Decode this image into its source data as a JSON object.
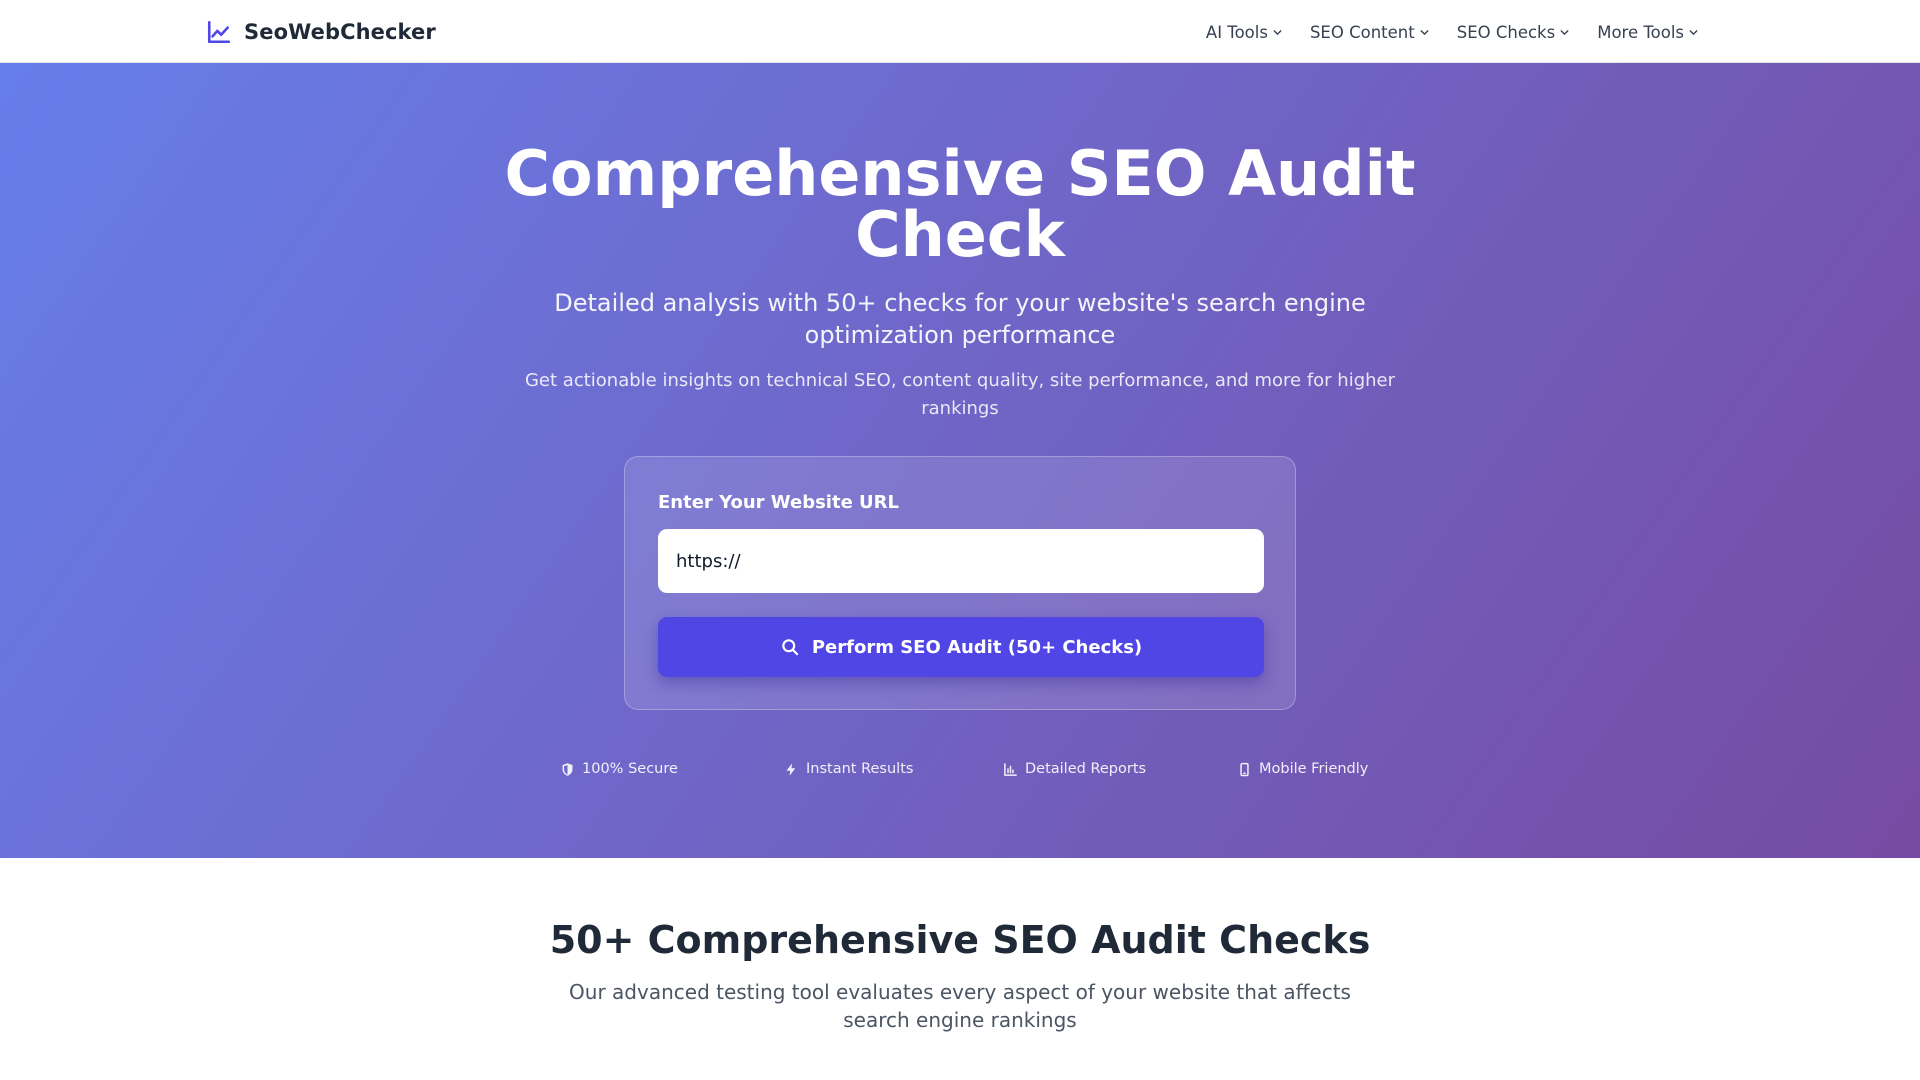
{
  "header": {
    "brand": "SeoWebChecker",
    "nav": [
      {
        "label": "AI Tools"
      },
      {
        "label": "SEO Content"
      },
      {
        "label": "SEO Checks"
      },
      {
        "label": "More Tools"
      }
    ]
  },
  "hero": {
    "title": "Comprehensive SEO Audit Check",
    "subtitle": "Detailed analysis with 50+ checks for your website's search engine optimization performance",
    "description": "Get actionable insights on technical SEO, content quality, site performance, and more for higher rankings"
  },
  "form": {
    "label": "Enter Your Website URL",
    "input_placeholder": "https://",
    "button_label": "Perform SEO Audit (50+ Checks)"
  },
  "features": [
    {
      "label": "100% Secure",
      "icon": "shield-icon"
    },
    {
      "label": "Instant Results",
      "icon": "bolt-icon"
    },
    {
      "label": "Detailed Reports",
      "icon": "chart-icon"
    },
    {
      "label": "Mobile Friendly",
      "icon": "mobile-icon"
    }
  ],
  "section": {
    "title": "50+ Comprehensive SEO Audit Checks",
    "subtitle": "Our advanced testing tool evaluates every aspect of your website that affects search engine rankings"
  },
  "colors": {
    "brand": "#4f46e5",
    "hero_start": "#667eea",
    "hero_end": "#764ba2",
    "text_dark": "#1f2937"
  }
}
